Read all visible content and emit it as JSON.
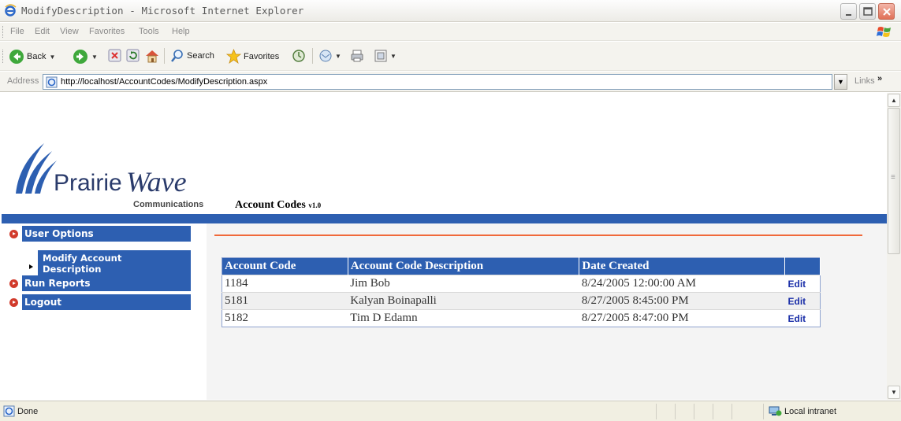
{
  "window": {
    "title": "ModifyDescription - Microsoft Internet Explorer"
  },
  "menu": [
    "File",
    "Edit",
    "View",
    "Favorites",
    "Tools",
    "Help"
  ],
  "toolbar": {
    "back_label": "Back",
    "search_label": "Search",
    "favorites_label": "Favorites"
  },
  "address": {
    "label": "Address",
    "url": "http://localhost/AccountCodes/ModifyDescription.aspx",
    "links_label": "Links",
    "links_chevron": "»"
  },
  "logo": {
    "name_part1": "Prairie",
    "name_part2": "Wave",
    "tagline": "Communications"
  },
  "app": {
    "name": "Account Codes",
    "version": "v1.0"
  },
  "nav": {
    "user_options": "User Options",
    "modify_line1": "Modify Account",
    "modify_line2": "Description",
    "run_reports": "Run Reports",
    "logout": "Logout"
  },
  "grid": {
    "headers": [
      "Account Code",
      "Account Code Description",
      "Date Created",
      ""
    ],
    "rows": [
      {
        "code": "1184",
        "description": "Jim Bob",
        "date": "8/24/2005 12:00:00 AM",
        "action": "Edit"
      },
      {
        "code": "5181",
        "description": "Kalyan Boinapalli",
        "date": "8/27/2005 8:45:00 PM",
        "action": "Edit"
      },
      {
        "code": "5182",
        "description": "Tim D Edamn",
        "date": "8/27/2005 8:47:00 PM",
        "action": "Edit"
      }
    ]
  },
  "status": {
    "text": "Done",
    "zone": "Local intranet"
  },
  "colors": {
    "brand_blue": "#2d5fb1",
    "accent_orange": "#f0693a",
    "nav_bullet": "#d13a2b",
    "link_blue": "#1a2ea8"
  }
}
